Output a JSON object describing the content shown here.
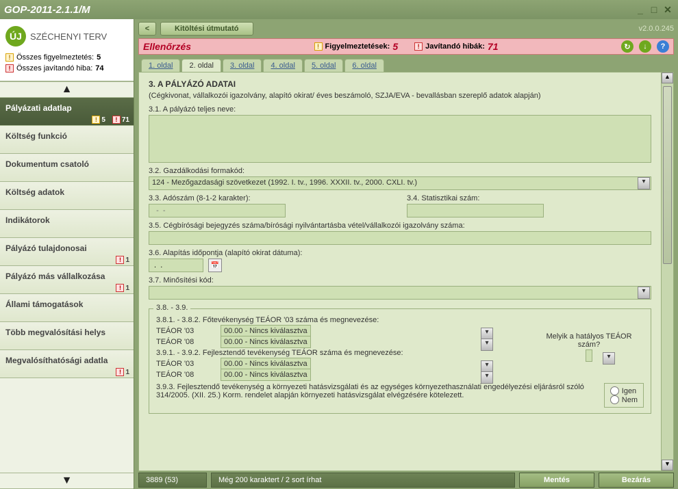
{
  "titlebar": {
    "title": "GOP-2011-2.1.1/M"
  },
  "logo": {
    "badge": "ÚJ",
    "text": "SZÉCHENYI TERV"
  },
  "summary": {
    "warn_label": "Összes figyelmeztetés:",
    "warn_count": "5",
    "err_label": "Összes javítandó hiba:",
    "err_count": "74"
  },
  "nav": [
    {
      "label": "Pályázati adatlap",
      "warn": "5",
      "err": "71",
      "active": true
    },
    {
      "label": "Költség funkció"
    },
    {
      "label": "Dokumentum csatoló"
    },
    {
      "label": "Költség adatok"
    },
    {
      "label": "Indikátorok"
    },
    {
      "label": "Pályázó tulajdonosai",
      "err": "1"
    },
    {
      "label": "Pályázó más vállalkozása",
      "err": "1"
    },
    {
      "label": "Állami támogatások"
    },
    {
      "label": "Több megvalósítási helys"
    },
    {
      "label": "Megvalósíthatósági adatla",
      "err": "1"
    }
  ],
  "toolbar": {
    "back": "<",
    "guide": "Kitöltési útmutató",
    "version": "v2.0.0.245"
  },
  "alert": {
    "title": "Ellenőrzés",
    "warn_label": "Figyelmeztetések:",
    "warn_count": "5",
    "err_label": "Javítandó hibák:",
    "err_count": "71"
  },
  "tabs": [
    "1. oldal",
    "2. oldal",
    "3. oldal",
    "4. oldal",
    "5. oldal",
    "6. oldal"
  ],
  "active_tab": 1,
  "form": {
    "h3": "3. A PÁLYÁZÓ ADATAI",
    "sub": "(Cégkivonat, vállalkozói igazolvány, alapító okirat/ éves beszámoló, SZJA/EVA - bevallásban szereplő adatok alapján)",
    "f31": "3.1. A pályázó teljes neve:",
    "f32": "3.2. Gazdálkodási formakód:",
    "f32v": "124 - Mezőgazdasági szövetkezet (1992. I. tv., 1996. XXXII. tv., 2000. CXLI. tv.)",
    "f33": "3.3. Adószám (8-1-2 karakter):",
    "f34": "3.4. Statisztikai szám:",
    "f33ph": "  -  -  ",
    "f35": "3.5. Cégbírósági bejegyzés száma/bírósági nyilvántartásba vétel/vállalkozói igazolvány száma:",
    "f36": "3.6. Alapítás időpontja (alapító okirat dátuma):",
    "f36v": " .  . ",
    "f37": "3.7. Minősítési kód:",
    "fs_legend": "3.8. - 3.9.",
    "f381": "3.8.1. - 3.8.2. Főtevékenység TEÁOR '03 száma és megnevezése:",
    "t03": "TEÁOR '03",
    "t08": "TEÁOR '08",
    "tval": "00.00 - Nincs kiválasztva",
    "f391": "3.9.1. - 3.9.2. Fejlesztendő tevékenység TEÁOR száma és megnevezése:",
    "sideq": "Melyik a hatályos TEÁOR szám?",
    "f393": "3.9.3. Fejlesztendő tevékenység a környezeti hatásvizsgálati és az egységes környezethasználati engedélyezési eljárásról szóló 314/2005. (XII. 25.) Korm. rendelet alapján környezeti hatásvizsgálat elvégzésére kötelezett.",
    "igen": "Igen",
    "nem": "Nem"
  },
  "status": {
    "left": "3889 (53)",
    "mid": "Még 200 karaktert / 2 sort írhat",
    "save": "Mentés",
    "close": "Bezárás"
  }
}
